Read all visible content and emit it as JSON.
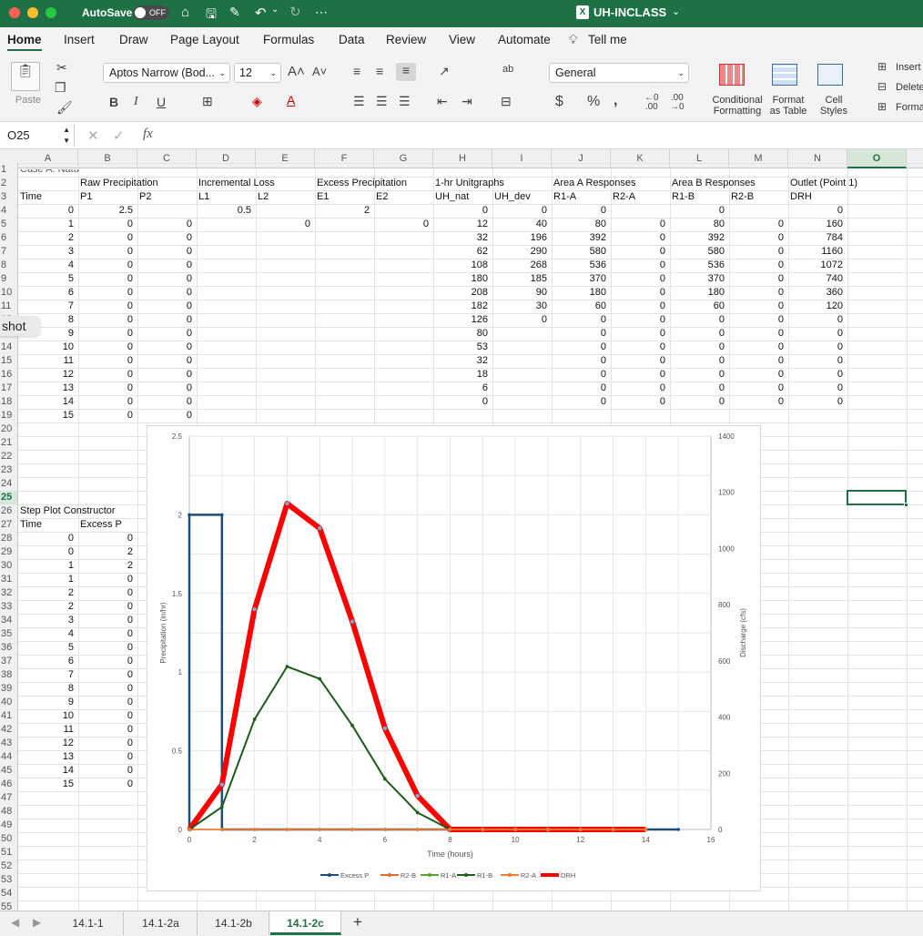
{
  "titlebar": {
    "autosave": "AutoSave",
    "toggle": "OFF",
    "doc_title": "UH-INCLASS",
    "more": "⋯"
  },
  "menu": {
    "tabs": [
      "Home",
      "Insert",
      "Draw",
      "Page Layout",
      "Formulas",
      "Data",
      "Review",
      "View",
      "Automate"
    ],
    "tell_me": "Tell me"
  },
  "ribbon": {
    "paste": "Paste",
    "font_name": "Aptos Narrow (Bod...",
    "font_size": "12",
    "number_format": "General",
    "conditional": "Conditional",
    "formatting": "Formatting",
    "format_as": "Format",
    "as_table": "as Table",
    "cell": "Cell",
    "styles": "Styles",
    "insert": "Insert",
    "delete": "Delete",
    "format": "Format",
    "bold": "B",
    "italic": "I",
    "underline": "U",
    "grow": "A^",
    "shrink": "A˅",
    "dollar": "$",
    "percent": "%",
    "comma": "ʔ",
    "inc_dec": "←.0 .00",
    "dec_dec": ".00 →0",
    "autosum": "ab",
    "wrap": "c↵"
  },
  "formula_bar": {
    "name_box": "O25",
    "fx": "fx",
    "cancel": "✕",
    "enter": "✓",
    "content": ""
  },
  "columns": [
    "A",
    "B",
    "C",
    "D",
    "E",
    "F",
    "G",
    "H",
    "I",
    "J",
    "K",
    "L",
    "M",
    "N",
    "O"
  ],
  "rows": [
    "1",
    "2",
    "3",
    "4",
    "5",
    "6",
    "7",
    "8",
    "9",
    "10",
    "11",
    "12",
    "13",
    "14",
    "15",
    "16",
    "17",
    "18",
    "19",
    "20",
    "21",
    "22",
    "23",
    "24",
    "25",
    "26",
    "27",
    "28",
    "29",
    "30",
    "31",
    "32",
    "33",
    "34",
    "35",
    "36",
    "37",
    "38",
    "39",
    "40",
    "41",
    "42",
    "43",
    "44",
    "45",
    "46",
    "47",
    "48",
    "49",
    "50",
    "51",
    "52",
    "53",
    "54",
    "55"
  ],
  "row1_cut": "Case A: Natural Conditions both areas",
  "headers2": {
    "B": "Raw Precipitation",
    "D": "Incremental Loss",
    "F": "Excess Precipitation",
    "H": "1-hr Unitgraphs",
    "J": "Area A Responses",
    "L": "Area B Responses",
    "N": "Outlet (Point 1)"
  },
  "headers3": {
    "A": "Time",
    "B": "P1",
    "C": "P2",
    "D": "L1",
    "E": "L2",
    "F": "E1",
    "G": "E2",
    "H": "UH_nat",
    "I": "UH_dev",
    "J": "R1-A",
    "K": "R2-A",
    "L": "R1-B",
    "M": "R2-B",
    "N": "DRH"
  },
  "table": [
    [
      "0",
      "2.5",
      "",
      "0.5",
      "",
      "2",
      "",
      "0",
      "0",
      "0",
      "",
      "0",
      "",
      "0"
    ],
    [
      "1",
      "0",
      "0",
      "",
      "0",
      "",
      "0",
      "12",
      "40",
      "80",
      "0",
      "80",
      "0",
      "160"
    ],
    [
      "2",
      "0",
      "0",
      "",
      "",
      "",
      "",
      "32",
      "196",
      "392",
      "0",
      "392",
      "0",
      "784"
    ],
    [
      "3",
      "0",
      "0",
      "",
      "",
      "",
      "",
      "62",
      "290",
      "580",
      "0",
      "580",
      "0",
      "1160"
    ],
    [
      "4",
      "0",
      "0",
      "",
      "",
      "",
      "",
      "108",
      "268",
      "536",
      "0",
      "536",
      "0",
      "1072"
    ],
    [
      "5",
      "0",
      "0",
      "",
      "",
      "",
      "",
      "180",
      "185",
      "370",
      "0",
      "370",
      "0",
      "740"
    ],
    [
      "6",
      "0",
      "0",
      "",
      "",
      "",
      "",
      "208",
      "90",
      "180",
      "0",
      "180",
      "0",
      "360"
    ],
    [
      "7",
      "0",
      "0",
      "",
      "",
      "",
      "",
      "182",
      "30",
      "60",
      "0",
      "60",
      "0",
      "120"
    ],
    [
      "8",
      "0",
      "0",
      "",
      "",
      "",
      "",
      "126",
      "0",
      "0",
      "0",
      "0",
      "0",
      "0"
    ],
    [
      "9",
      "0",
      "0",
      "",
      "",
      "",
      "",
      "80",
      "",
      "0",
      "0",
      "0",
      "0",
      "0"
    ],
    [
      "10",
      "0",
      "0",
      "",
      "",
      "",
      "",
      "53",
      "",
      "0",
      "0",
      "0",
      "0",
      "0"
    ],
    [
      "11",
      "0",
      "0",
      "",
      "",
      "",
      "",
      "32",
      "",
      "0",
      "0",
      "0",
      "0",
      "0"
    ],
    [
      "12",
      "0",
      "0",
      "",
      "",
      "",
      "",
      "18",
      "",
      "0",
      "0",
      "0",
      "0",
      "0"
    ],
    [
      "13",
      "0",
      "0",
      "",
      "",
      "",
      "",
      "6",
      "",
      "0",
      "0",
      "0",
      "0",
      "0"
    ],
    [
      "14",
      "0",
      "0",
      "",
      "",
      "",
      "",
      "0",
      "",
      "0",
      "0",
      "0",
      "0",
      "0"
    ],
    [
      "15",
      "0",
      "0",
      "",
      "",
      "",
      "",
      "",
      "",
      "",
      "",
      "",
      "",
      ""
    ]
  ],
  "step": {
    "title": "Step Plot Constructor",
    "time_label": "Time",
    "excess_label": "Excess P",
    "rows": [
      [
        "0",
        "0"
      ],
      [
        "0",
        "2"
      ],
      [
        "1",
        "2"
      ],
      [
        "1",
        "0"
      ],
      [
        "2",
        "0"
      ],
      [
        "2",
        "0"
      ],
      [
        "3",
        "0"
      ],
      [
        "4",
        "0"
      ],
      [
        "5",
        "0"
      ],
      [
        "6",
        "0"
      ],
      [
        "7",
        "0"
      ],
      [
        "8",
        "0"
      ],
      [
        "9",
        "0"
      ],
      [
        "10",
        "0"
      ],
      [
        "11",
        "0"
      ],
      [
        "12",
        "0"
      ],
      [
        "13",
        "0"
      ],
      [
        "14",
        "0"
      ],
      [
        "15",
        "0"
      ]
    ]
  },
  "tooltip": "shot",
  "chart_data": {
    "type": "line",
    "xlabel": "Time (hours)",
    "ylabel": "Precipitation (in/hr)",
    "y2label": "Discharge (cfs)",
    "xlim": [
      0,
      16
    ],
    "ylim": [
      0,
      2.5
    ],
    "y2lim": [
      0,
      1400
    ],
    "xticks": [
      "0",
      "2",
      "4",
      "6",
      "8",
      "10",
      "12",
      "14",
      "16"
    ],
    "yticks": [
      "0",
      "0.5",
      "1",
      "1.5",
      "2",
      "2.5"
    ],
    "y2ticks": [
      "0",
      "200",
      "400",
      "600",
      "800",
      "1000",
      "1200",
      "1400"
    ],
    "grid": true,
    "legend": "bottom",
    "series": [
      {
        "name": "Excess P",
        "axis": "left",
        "color": "#1f4e79",
        "x": [
          0,
          0,
          1,
          1,
          2,
          3,
          4,
          5,
          6,
          7,
          8,
          9,
          10,
          11,
          12,
          13,
          14,
          15
        ],
        "y": [
          0,
          2,
          2,
          0,
          0,
          0,
          0,
          0,
          0,
          0,
          0,
          0,
          0,
          0,
          0,
          0,
          0,
          0
        ]
      },
      {
        "name": "R2-B",
        "axis": "right",
        "color": "#e26b2a",
        "x": [
          0,
          1,
          2,
          3,
          4,
          5,
          6,
          7,
          8,
          9,
          10,
          11,
          12,
          13,
          14
        ],
        "y": [
          0,
          0,
          0,
          0,
          0,
          0,
          0,
          0,
          0,
          0,
          0,
          0,
          0,
          0,
          0
        ]
      },
      {
        "name": "R1-A",
        "axis": "right",
        "color": "#5aa02c",
        "x": [
          0,
          1,
          2,
          3,
          4,
          5,
          6,
          7,
          8,
          9,
          10,
          11,
          12,
          13,
          14
        ],
        "y": [
          0,
          80,
          392,
          580,
          536,
          370,
          180,
          60,
          0,
          0,
          0,
          0,
          0,
          0,
          0
        ]
      },
      {
        "name": "R1-B",
        "axis": "right",
        "color": "#1e5c1e",
        "x": [
          0,
          1,
          2,
          3,
          4,
          5,
          6,
          7,
          8,
          9,
          10,
          11,
          12,
          13,
          14
        ],
        "y": [
          0,
          80,
          392,
          580,
          536,
          370,
          180,
          60,
          0,
          0,
          0,
          0,
          0,
          0,
          0
        ]
      },
      {
        "name": "R2-A",
        "axis": "right",
        "color": "#f07c30",
        "x": [
          0,
          1,
          2,
          3,
          4,
          5,
          6,
          7,
          8,
          9,
          10,
          11,
          12,
          13,
          14
        ],
        "y": [
          0,
          0,
          0,
          0,
          0,
          0,
          0,
          0,
          0,
          0,
          0,
          0,
          0,
          0,
          0
        ]
      },
      {
        "name": "DRH",
        "axis": "right",
        "color": "#ff0000",
        "x": [
          0,
          1,
          2,
          3,
          4,
          5,
          6,
          7,
          8,
          9,
          10,
          11,
          12,
          13,
          14
        ],
        "y": [
          0,
          160,
          784,
          1160,
          1072,
          740,
          360,
          120,
          0,
          0,
          0,
          0,
          0,
          0,
          0
        ]
      }
    ]
  },
  "sheets": [
    "14.1-1",
    "14.1-2a",
    "14.1-2b",
    "14.1-2c"
  ],
  "active_sheet": "14.1-2c",
  "add_sheet": "+"
}
